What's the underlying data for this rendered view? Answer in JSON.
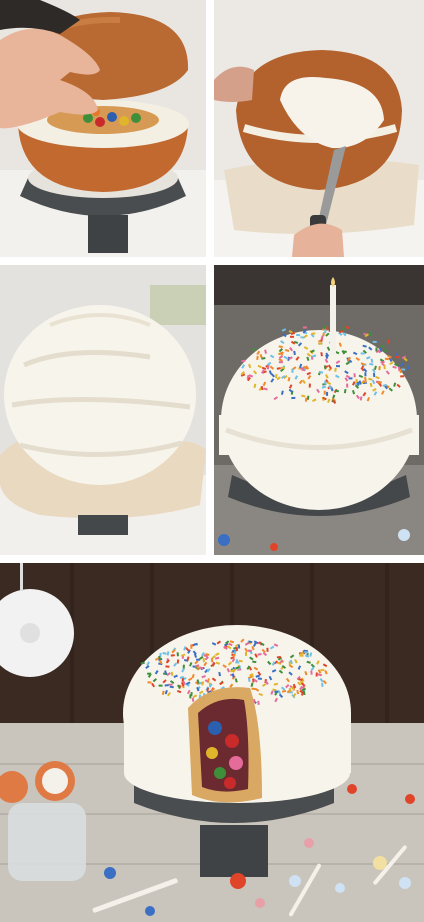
{
  "collage": {
    "panel_count": 5,
    "colors": {
      "background": "#ffffff",
      "cake_crumb": "#c9743a",
      "frosting": "#f7f3ea",
      "stand": "#4a4d4f",
      "wood_wall": "#3b2a22",
      "table": "#c9c4bc"
    }
  },
  "panels": [
    {
      "id": "step-1",
      "icon": "cake-dome-lifting"
    },
    {
      "id": "step-2",
      "icon": "frosting-spatula"
    },
    {
      "id": "step-3",
      "icon": "frosted-dome"
    },
    {
      "id": "step-4",
      "icon": "sprinkles-candle"
    },
    {
      "id": "step-5",
      "icon": "candy-filled-slice"
    }
  ]
}
